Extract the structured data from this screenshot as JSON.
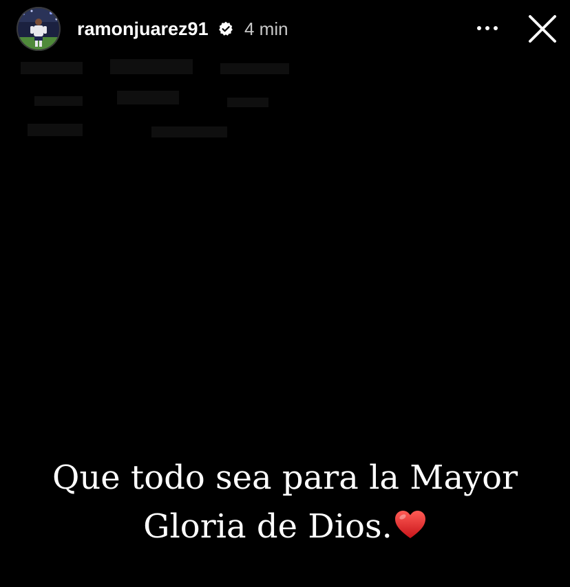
{
  "header": {
    "username": "ramonjuarez91",
    "time": "4 min",
    "avatar_icon": "profile-photo-soccer-player",
    "verified_icon": "verified-badge-icon",
    "more_icon": "more-options-icon",
    "close_icon": "close-icon"
  },
  "story": {
    "caption_line1": "Que todo sea para la Mayor",
    "caption_line2": "Gloria de Dios.",
    "emoji": "heart-emoji",
    "background_color": "#000000",
    "text_color": "#ffffff",
    "heart_color": "#e0201f"
  }
}
